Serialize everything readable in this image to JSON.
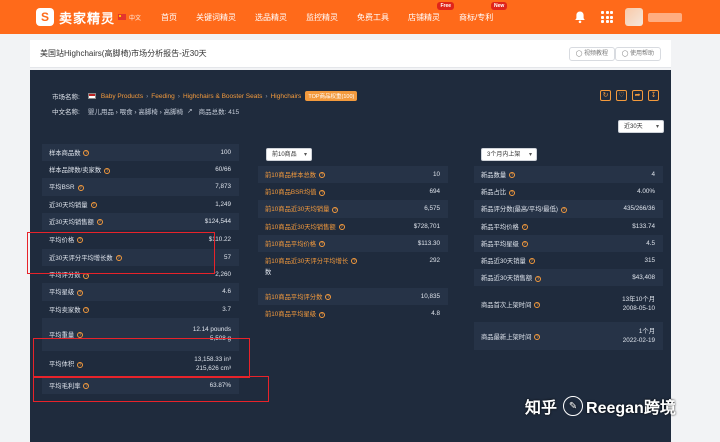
{
  "nav": {
    "logo_mark": "S",
    "logo_text": "卖家精灵",
    "lang": "中文",
    "items": [
      {
        "label": "首页"
      },
      {
        "label": "关键词精灵"
      },
      {
        "label": "选品精灵"
      },
      {
        "label": "监控精灵"
      },
      {
        "label": "免费工具"
      },
      {
        "label": "店铺精灵",
        "badge": "Free"
      },
      {
        "label": "商标/专利",
        "badge": "New"
      }
    ]
  },
  "titlebar": {
    "title": "美国站Highchairs(高脚椅)市场分析报告-近30天",
    "video_tutorial": "视频教程",
    "help": "使用帮助"
  },
  "market": {
    "market_label": "市场名称:",
    "category_path": [
      "Baby Products",
      "Feeding",
      "Highchairs & Booster Seats",
      "Highchairs"
    ],
    "tag": "TOP商品权重(100)",
    "cn_label": "中文名称:",
    "cn_path": "婴儿用品 › 喂食 › 高脚椅 › 高脚椅",
    "product_count": "商品总数: 415",
    "period_select": "近30天"
  },
  "table1": {
    "rows": [
      {
        "label": "样本商品数",
        "value": "100"
      },
      {
        "label": "样本品牌数/卖家数",
        "value": "60/66"
      },
      {
        "label": "平均BSR",
        "value": "7,873"
      },
      {
        "label": "近30天均销量",
        "value": "1,249"
      },
      {
        "label": "近30天均销售额",
        "value": "$124,544"
      },
      {
        "label": "平均价格",
        "value": "$110.22"
      },
      {
        "label": "近30天评分平均增长数",
        "value": "57"
      },
      {
        "label": "平均评分数",
        "value": "2,260"
      },
      {
        "label": "平均星级",
        "value": "4.6"
      },
      {
        "label": "平均卖家数",
        "value": "3.7"
      },
      {
        "label": "平均重量",
        "value": "12.14 pounds",
        "value2": "5,508 g"
      },
      {
        "label": "平均体积",
        "value": "13,158.33 in³",
        "value2": "215,626 cm³"
      },
      {
        "label": "平均毛利率",
        "value": "63.87%"
      }
    ]
  },
  "table2": {
    "select": "前10商品",
    "rows": [
      {
        "label": "前10商品样本总数",
        "value": "10"
      },
      {
        "label": "前10商品BSR均值",
        "value": "694"
      },
      {
        "label": "前10商品近30天均销量",
        "value": "6,575"
      },
      {
        "label": "前10商品近30天均销售额",
        "value": "$728,701"
      },
      {
        "label": "前10商品平均价格",
        "value": "$113.30"
      },
      {
        "label": "前10商品近30天评分平均增长",
        "label2": "数",
        "value": "292"
      },
      {
        "label": "前10商品平均评分数",
        "value": "10,835"
      },
      {
        "label": "前10商品平均星级",
        "value": "4.8"
      }
    ]
  },
  "table3": {
    "select": "3个月内上架",
    "rows": [
      {
        "label": "新品数量",
        "value": "4"
      },
      {
        "label": "新品占比",
        "value": "4.00%"
      },
      {
        "label": "新品评分数(最高/平均/最低)",
        "value": "435/266/36"
      },
      {
        "label": "新品平均价格",
        "value": "$133.74"
      },
      {
        "label": "新品平均星级",
        "value": "4.5"
      },
      {
        "label": "新品近30天销量",
        "value": "315"
      },
      {
        "label": "新品近30天销售额",
        "value": "$43,408"
      },
      {
        "label": "商品首次上架时间",
        "value": "13年10个月",
        "value2": "2008-05-10"
      },
      {
        "label": "商品最新上架时间",
        "value": "1个月",
        "value2": "2022-02-19"
      }
    ]
  },
  "watermark": {
    "left": "知乎",
    "right": "Reegan跨境"
  },
  "colors": {
    "nav": "#ff6a1a",
    "panel": "#1f2b3d",
    "accent": "#f39a3d",
    "highlight": "#e8232a"
  }
}
